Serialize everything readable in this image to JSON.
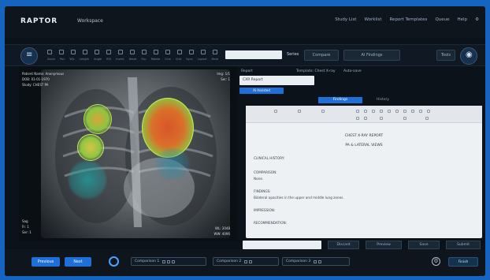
{
  "app": {
    "brand": "RAPTOR",
    "workspace": "Workspace"
  },
  "topnav": [
    "Study List",
    "Worklist",
    "Report Templates",
    "Queue",
    "Help",
    "⚙"
  ],
  "toolbar": {
    "left_icon": "menu-icon",
    "tools": [
      "Zoom",
      "Pan",
      "W/L",
      "Length",
      "Angle",
      "ROI",
      "Invert",
      "Reset",
      "Flip",
      "Rotate",
      "Cine",
      "Grid",
      "Sync",
      "Layout",
      "More"
    ],
    "search_value": "",
    "search_label": "Series",
    "btn_compare": "Compare",
    "btn_ai": "AI Findings",
    "btn_small": "Tools",
    "right_icon": "user-icon"
  },
  "viewer": {
    "overlay_tl": [
      "Patient Name: Anonymous",
      "DOB: 01-01-1970",
      "Study: CHEST PA"
    ],
    "overlay_tr": [
      "Img: 1/1",
      "Ser: 1"
    ],
    "overlay_bl": [
      "Sag",
      "Fr: 1",
      "Ser: 1"
    ],
    "overlay_br": [
      "WL: 2048",
      "WW: 4096"
    ],
    "heat_colors": {
      "hot": "#d9542a",
      "warm": "#8cc63f",
      "cool": "#1fa3a3"
    }
  },
  "right_panel": {
    "header_left": "Report",
    "header_mid": "Template: Chest X-ray",
    "header_right": "Auto-save",
    "select_value": "CXR Report",
    "badge": "AI Assisted",
    "tabs": [
      {
        "label": "Findings",
        "active": true
      },
      {
        "label": "History",
        "active": false
      }
    ],
    "editor": {
      "heading1": "CHEST X-RAY REPORT",
      "heading2": "PA & LATERAL VIEWS",
      "lines": [
        "CLINICAL HISTORY:",
        "COMPARISON:",
        "None.",
        "FINDINGS:",
        "Bilateral opacities in the upper and middle lung zones.",
        "IMPRESSION:",
        "RECOMMENDATION:"
      ]
    },
    "bottom_input_value": "",
    "bottom_buttons": [
      "Discard",
      "Preview",
      "Save",
      "Submit"
    ]
  },
  "bottombar": {
    "btn_prev": "Previous",
    "btn_next": "Next",
    "seg1": "Comparison 1",
    "seg2": "Comparison 2",
    "seg3": "Comparison 3",
    "settings_icon": "gear-icon",
    "finish_label": "Finish"
  }
}
